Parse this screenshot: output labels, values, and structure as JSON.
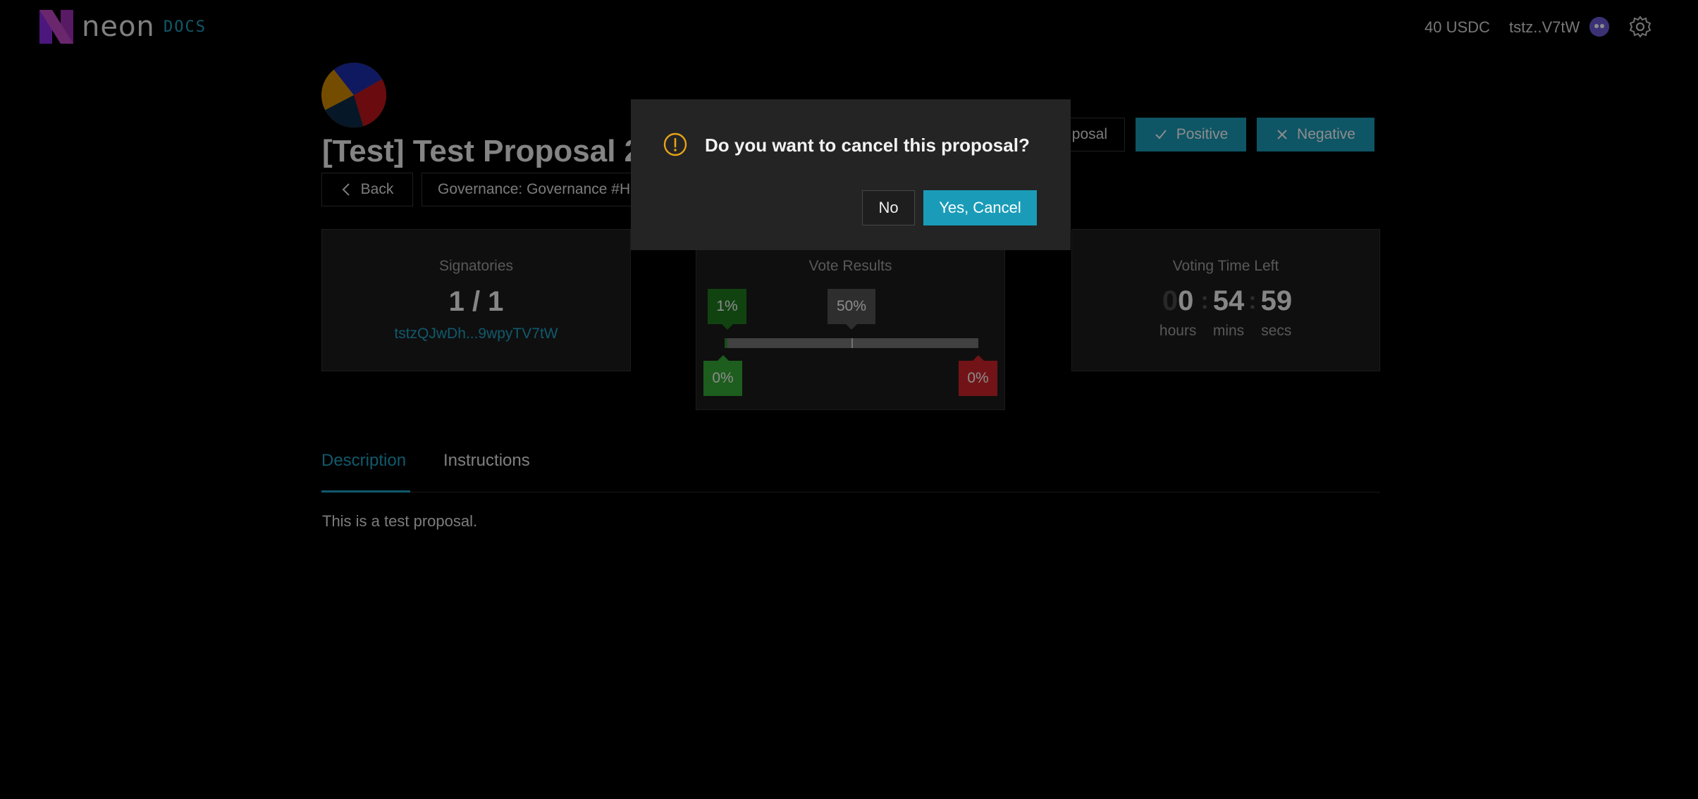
{
  "header": {
    "brand": "neon",
    "docs_label": "DOCS",
    "balance": "40 USDC",
    "wallet_short": "tstz..V7tW",
    "icons": {
      "logo": "neon-logo-icon",
      "wallet": "wallet-avatar-icon",
      "settings": "gear-icon"
    }
  },
  "proposal": {
    "title": "[Test] Test Proposal 2",
    "back_label": "Back",
    "governance_label": "Governance: Governance #H",
    "cancel_label_partial": "posal",
    "positive_label": "Positive",
    "negative_label": "Negative"
  },
  "signatories": {
    "label": "Signatories",
    "count": "1 / 1",
    "address": "tstzQJwDh...9wpyTV7tW"
  },
  "vote_results": {
    "label": "Vote Results",
    "quorum_pct": "1%",
    "threshold_pct": "50%",
    "yes_pct": "0%",
    "no_pct": "0%",
    "bar_yes_fraction": 0.01,
    "bar_threshold_fraction": 0.5
  },
  "voting_time": {
    "label": "Voting Time Left",
    "hours_faint": "0",
    "hours": "0",
    "mins": "54",
    "secs": "59",
    "hours_label": "hours",
    "mins_label": "mins",
    "secs_label": "secs",
    "separator": ":"
  },
  "tabs": [
    {
      "label": "Description",
      "active": true
    },
    {
      "label": "Instructions",
      "active": false
    }
  ],
  "description_text": "This is a test proposal.",
  "modal": {
    "title": "Do you want to cancel this proposal?",
    "no_label": "No",
    "yes_label": "Yes, Cancel",
    "icon": "warning-circle-icon"
  },
  "colors": {
    "accent": "#1a9cb8",
    "link": "#1fa2c4",
    "positive": "#35a935",
    "negative": "#d0262b",
    "warning": "#e8a317"
  }
}
